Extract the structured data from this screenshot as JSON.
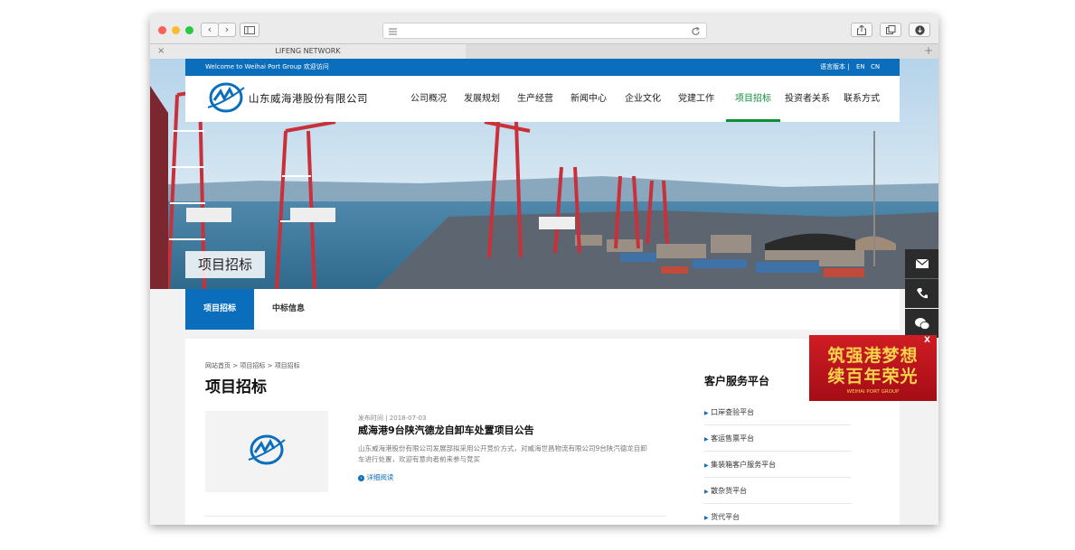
{
  "browser": {
    "tab_title": "LIFENG NETWORK",
    "close_glyph": "×",
    "new_tab_glyph": "+"
  },
  "topbar": {
    "welcome": "Welcome to Weihai Port Group 欢迎访问",
    "lang_label": "语言版本 |",
    "lang_en": "EN",
    "lang_cn": "CN"
  },
  "header": {
    "company": "山东威海港股份有限公司",
    "menu": [
      "公司概况",
      "发展规划",
      "生产经营",
      "新闻中心",
      "企业文化",
      "党建工作",
      "项目招标",
      "投资者关系",
      "联系方式"
    ]
  },
  "hero": {
    "title": "项目招标"
  },
  "subnav": {
    "tabs": [
      "项目招标",
      "中标信息"
    ]
  },
  "main": {
    "breadcrumb": [
      "网站首页",
      "项目招标",
      "项目招标"
    ],
    "breadcrumb_sep": ">",
    "page_title": "项目招标",
    "article": {
      "date": "发布时间 | 2018-07-03",
      "title": "威海港9台陕汽德龙自卸车处置项目公告",
      "summary_line1": "山东威海港股份有限公司发展部拟采用公开竞价方式，对威海世昌物流有限公司9台陕汽德龙自卸",
      "summary_line2": "车进行处置，欢迎有意向者前来参与竞买",
      "read_more": "详细阅读"
    }
  },
  "sidebar": {
    "title": "客户服务平台",
    "items": [
      "口岸查验平台",
      "客运售票平台",
      "集装箱客户服务平台",
      "散杂货平台",
      "货代平台"
    ]
  },
  "banner": {
    "line1": "筑强港梦想",
    "line2": "续百年荣光",
    "sub": "WEIHAI PORT GROUP",
    "close": "X"
  },
  "icons": [
    "mail-icon",
    "phone-icon",
    "wechat-icon",
    "share-icon",
    "tabs-icon",
    "download-icon",
    "reload-icon",
    "sidebar-icon",
    "back-icon",
    "forward-icon"
  ],
  "colors": {
    "brand_blue": "#0b6ebd",
    "active_green": "#0f8e3a",
    "banner_red": "#c1121f",
    "banner_gold": "#f7d24a"
  }
}
